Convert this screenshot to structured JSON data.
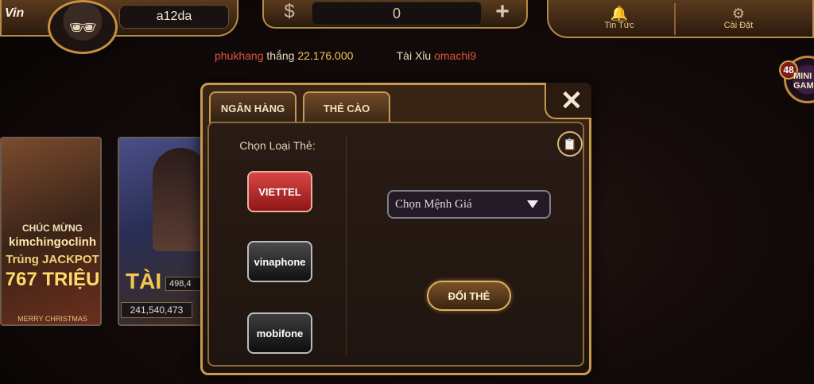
{
  "header": {
    "logo_text": "Vin",
    "username": "a12da",
    "balance": "0",
    "dollar_symbol": "$",
    "plus_symbol": "+",
    "nav": [
      {
        "label": "Tin Tức",
        "icon": "bell-icon"
      },
      {
        "label": "Cài Đặt",
        "icon": "gear-icon"
      }
    ]
  },
  "ticker": {
    "winner_name": "phukhang",
    "winner_verb": "thắng",
    "winner_amount": "22.176.000",
    "game_name": "Tài Xỉu",
    "next_user": "omachi9"
  },
  "mini_game": {
    "count": "48",
    "label": "MINI GAME"
  },
  "banners": {
    "jackpot": {
      "line1": "CHÚC MỪNG",
      "line2": "kimchingoclinh",
      "line3": "Trúng JACKPOT",
      "line4": "767 TRIỆU",
      "footer": "MERRY CHRISTMAS"
    },
    "taixiu": {
      "title": "TÀI",
      "value1": "498,4",
      "value2": "241,540,473"
    }
  },
  "modal": {
    "tabs": [
      {
        "label": "NGÂN HÀNG"
      },
      {
        "label": "THẺ CÀO"
      }
    ],
    "close_label": "✕",
    "card_type_label": "Chọn Loại Thẻ:",
    "carriers": [
      {
        "label": "VIETTEL"
      },
      {
        "label": "vinaphone"
      },
      {
        "label": "mobifone"
      }
    ],
    "select_placeholder": "Chọn Mệnh Giá",
    "submit_label": "ĐỔI THẺ"
  },
  "colors": {
    "accent_gold": "#c69a52",
    "ticker_user": "#e0563c",
    "ticker_amount": "#f1c75a"
  }
}
